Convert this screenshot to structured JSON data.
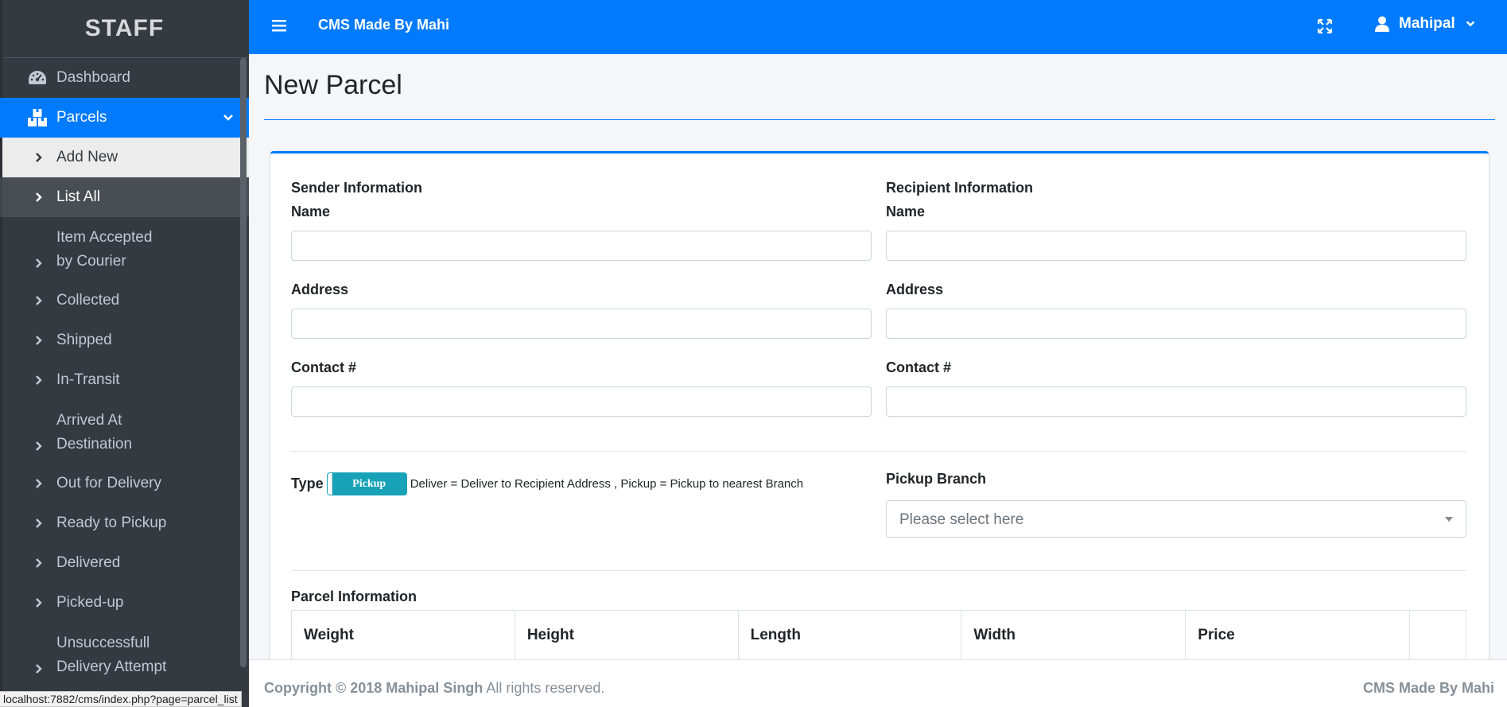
{
  "sidebar": {
    "brand": "STAFF",
    "dashboard": "Dashboard",
    "parcels": "Parcels",
    "items": [
      {
        "line1": "Add New"
      },
      {
        "line1": "List All"
      },
      {
        "line1": "Item Accepted",
        "line2": "by Courier"
      },
      {
        "line1": "Collected"
      },
      {
        "line1": "Shipped"
      },
      {
        "line1": "In-Transit"
      },
      {
        "line1": "Arrived At",
        "line2": "Destination"
      },
      {
        "line1": "Out for Delivery"
      },
      {
        "line1": "Ready to Pickup"
      },
      {
        "line1": "Delivered"
      },
      {
        "line1": "Picked-up"
      },
      {
        "line1": "Unsuccessfull",
        "line2": "Delivery Attempt"
      }
    ]
  },
  "header": {
    "title": "CMS Made By Mahi",
    "user": "Mahipal"
  },
  "page": {
    "title": "New Parcel"
  },
  "form": {
    "sender_heading": "Sender Information",
    "recipient_heading": "Recipient Information",
    "name_label": "Name",
    "address_label": "Address",
    "contact_label": "Contact #",
    "sender_name": "",
    "sender_address": "",
    "sender_contact": "",
    "recipient_name": "",
    "recipient_address": "",
    "recipient_contact": "",
    "type_label": "Type",
    "type_toggle": "Pickup",
    "type_help": "Deliver = Deliver to Recipient Address , Pickup = Pickup to nearest Branch",
    "pickup_branch_label": "Pickup Branch",
    "pickup_branch_placeholder": "Please select here",
    "parcel_info_heading": "Parcel Information",
    "parcel_columns": [
      "Weight",
      "Height",
      "Length",
      "Width",
      "Price",
      ""
    ]
  },
  "footer": {
    "copyright_bold": "Copyright © 2018 Mahipal Singh",
    "copyright_rest": "All rights reserved.",
    "right": "CMS Made By Mahi"
  },
  "statusbar": {
    "url": "localhost:7882/cms/index.php?page=parcel_list"
  },
  "colors": {
    "primary": "#007bff",
    "sidebar": "#343a40",
    "toggle": "#17a2b8"
  }
}
